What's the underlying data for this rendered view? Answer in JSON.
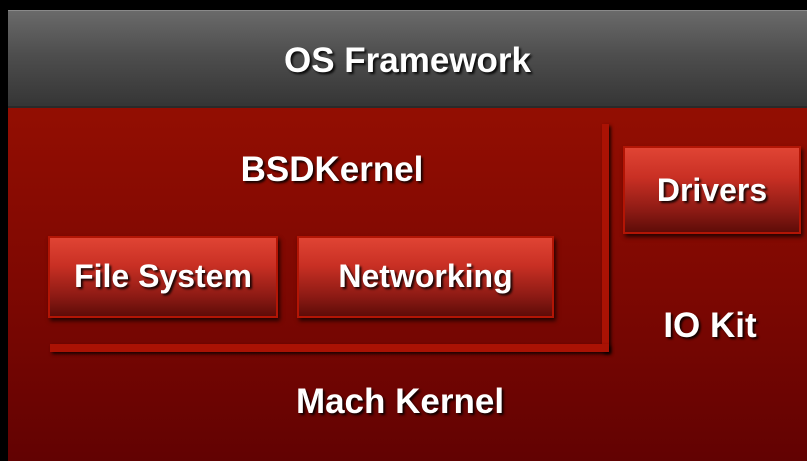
{
  "diagram": {
    "framework": {
      "label": "OS Framework"
    },
    "bsd": {
      "label": "BSDKernel"
    },
    "components": {
      "file_system": "File System",
      "networking": "Networking",
      "drivers": "Drivers"
    },
    "iokit": {
      "label": "IO Kit"
    },
    "mach": {
      "label": "Mach Kernel"
    }
  }
}
